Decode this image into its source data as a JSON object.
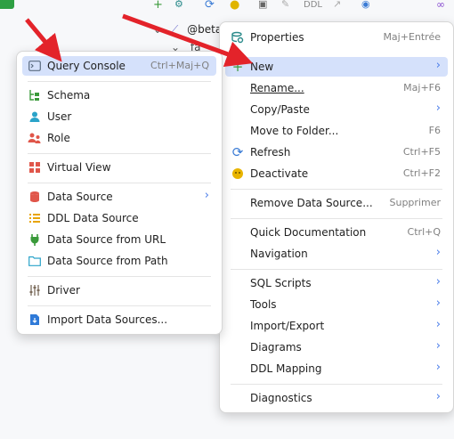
{
  "colors": {
    "highlight": "#d5e1fb",
    "arrow": "#e3232a",
    "accent": "#4a7dea",
    "separator": "#e4e4e4"
  },
  "background": {
    "toolbar_text": "DDL",
    "tree_row_1": "@beta",
    "tree_row_2": "fa"
  },
  "right_menu": {
    "items": [
      {
        "id": "properties",
        "icon": "properties-icon",
        "label": "Properties",
        "shortcut": "Maj+Entrée"
      },
      {
        "id": "new",
        "icon": "plus-icon",
        "label": "New",
        "submenu": true,
        "highlighted": true
      },
      {
        "id": "rename",
        "label": "Rename...",
        "shortcut": "Maj+F6"
      },
      {
        "id": "copy-paste",
        "label": "Copy/Paste",
        "submenu": true
      },
      {
        "id": "move-to-folder",
        "label": "Move to Folder...",
        "shortcut": "F6"
      },
      {
        "id": "refresh",
        "icon": "refresh-icon",
        "label": "Refresh",
        "shortcut": "Ctrl+F5"
      },
      {
        "id": "deactivate",
        "icon": "deactivate-icon",
        "label": "Deactivate",
        "shortcut": "Ctrl+F2"
      },
      {
        "id": "remove-data-source",
        "label": "Remove Data Source...",
        "shortcut": "Supprimer"
      },
      {
        "id": "quick-documentation",
        "label": "Quick Documentation",
        "shortcut": "Ctrl+Q"
      },
      {
        "id": "navigation",
        "label": "Navigation",
        "submenu": true
      },
      {
        "id": "sql-scripts",
        "label": "SQL Scripts",
        "submenu": true
      },
      {
        "id": "tools",
        "label": "Tools",
        "submenu": true
      },
      {
        "id": "import-export",
        "label": "Import/Export",
        "submenu": true
      },
      {
        "id": "diagrams",
        "label": "Diagrams",
        "submenu": true
      },
      {
        "id": "ddl-mapping",
        "label": "DDL Mapping",
        "submenu": true
      },
      {
        "id": "diagnostics",
        "label": "Diagnostics",
        "submenu": true
      }
    ]
  },
  "left_menu": {
    "items": [
      {
        "id": "query-console",
        "icon": "console-icon",
        "label": "Query Console",
        "shortcut": "Ctrl+Maj+Q",
        "highlighted": true
      },
      {
        "id": "schema",
        "icon": "schema-icon",
        "label": "Schema"
      },
      {
        "id": "user",
        "icon": "user-icon",
        "label": "User"
      },
      {
        "id": "role",
        "icon": "role-icon",
        "label": "Role"
      },
      {
        "id": "virtual-view",
        "icon": "virtual-view-icon",
        "label": "Virtual View"
      },
      {
        "id": "data-source",
        "icon": "database-icon",
        "label": "Data Source",
        "submenu": true
      },
      {
        "id": "ddl-data-source",
        "icon": "ddl-icon",
        "label": "DDL Data Source"
      },
      {
        "id": "data-source-from-url",
        "icon": "plug-icon",
        "label": "Data Source from URL"
      },
      {
        "id": "data-source-from-path",
        "icon": "folder-icon",
        "label": "Data Source from Path"
      },
      {
        "id": "driver",
        "icon": "driver-icon",
        "label": "Driver"
      },
      {
        "id": "import-data-sources",
        "icon": "import-icon",
        "label": "Import Data Sources..."
      }
    ]
  }
}
